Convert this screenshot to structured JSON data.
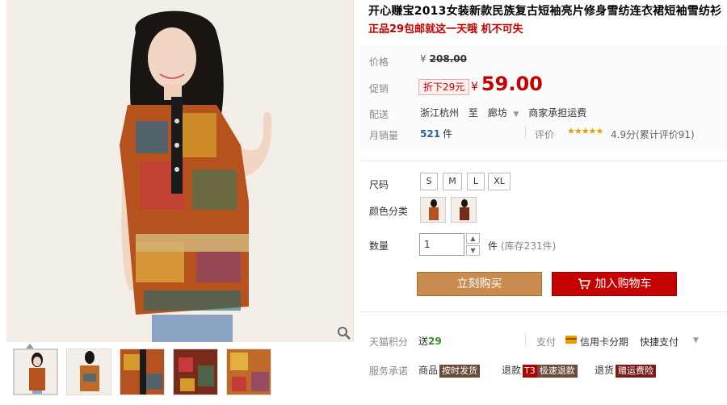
{
  "product": {
    "title": "开心赚宝2013女装新款民族复古短袖亮片修身雪纺连衣裙短袖雪纺衫",
    "subtitle": "正品29包邮就这一天哦 机不可失"
  },
  "price": {
    "label": "价格",
    "currency": "¥",
    "original": "208.00"
  },
  "promo": {
    "label": "促销",
    "tag": "折下29元",
    "currency": "¥",
    "value": "59.00"
  },
  "delivery": {
    "label": "配送",
    "from": "浙江杭州",
    "to_word": "至",
    "to": "廊坊",
    "caret": "▼",
    "fee": "商家承担运费"
  },
  "sales": {
    "label": "月销量",
    "count": "521",
    "unit": "件",
    "rating_label": "评价",
    "stars": "★★★★★",
    "rating_text": "4.9分(累计评价91)"
  },
  "size": {
    "label": "尺码",
    "options": [
      "S",
      "M",
      "L",
      "XL"
    ]
  },
  "color": {
    "label": "颜色分类"
  },
  "quantity": {
    "label": "数量",
    "value": "1",
    "up": "▲",
    "down": "▼",
    "unit": "件",
    "stock": "(库存231件)"
  },
  "actions": {
    "buy": "立刻购买",
    "cart": "加入购物车"
  },
  "points": {
    "label": "天猫积分",
    "prefix": "送",
    "value": "29"
  },
  "payment": {
    "label": "支付",
    "method1": "信用卡分期",
    "method2": "快捷支付",
    "caret": "▼"
  },
  "service": {
    "label": "服务承诺",
    "item1_prefix": "商品",
    "item1_tag": "按时发货",
    "item2_prefix": "退款",
    "item2_tag": "极速退款",
    "item2_icon": "T3",
    "item3_prefix": "退货",
    "item3_tag": "赠运费险"
  },
  "colors": {
    "accent_red": "#c40000",
    "buy_button": "#c98c4e",
    "star": "#e5a000"
  }
}
